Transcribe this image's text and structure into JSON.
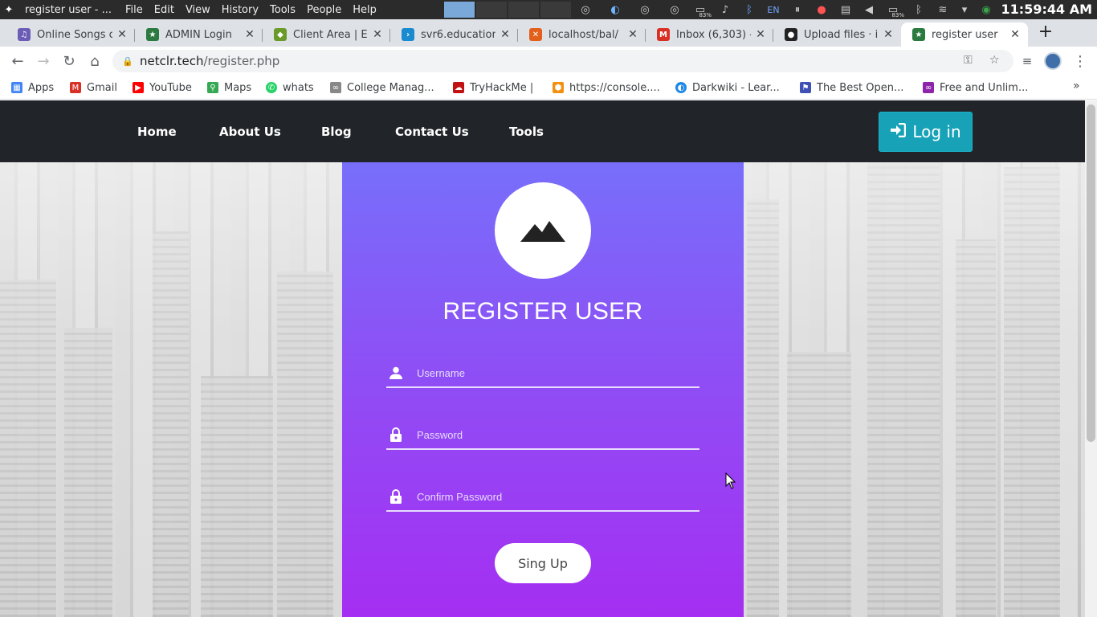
{
  "system_bar": {
    "window_title": "register user - ...",
    "menu": [
      "File",
      "Edit",
      "View",
      "History",
      "Tools",
      "People",
      "Help"
    ],
    "language": "EN",
    "cpu_level": "83%",
    "battery_level": "83%",
    "clock": "11:59:44 AM"
  },
  "tabs": [
    {
      "label": "Online Songs c",
      "icon": "music-favicon",
      "color": "#6b5db5"
    },
    {
      "label": "ADMIN Login",
      "icon": "admin-favicon",
      "color": "#2b7a3f"
    },
    {
      "label": "Client Area | E",
      "icon": "cube-favicon",
      "color": "#6a9a2a"
    },
    {
      "label": "svr6.education",
      "icon": "chevron-favicon",
      "color": "#1a8ad1"
    },
    {
      "label": "localhost/bal/",
      "icon": "xampp-favicon",
      "color": "#e2601c"
    },
    {
      "label": "Inbox (6,303) -",
      "icon": "gmail-favicon",
      "color": "#d93025"
    },
    {
      "label": "Upload files · i",
      "icon": "github-favicon",
      "color": "#222222"
    },
    {
      "label": "register user",
      "icon": "admin-favicon",
      "color": "#2b7a3f",
      "active": true
    }
  ],
  "toolbar": {
    "url_host": "netclr.tech",
    "url_path": "/register.php"
  },
  "bookmarks": [
    {
      "label": "Apps",
      "icon": "apps-grid-icon",
      "color": "#4285f4"
    },
    {
      "label": "Gmail",
      "icon": "gmail-icon",
      "color": "#d93025"
    },
    {
      "label": "YouTube",
      "icon": "youtube-icon",
      "color": "#ff0000"
    },
    {
      "label": "Maps",
      "icon": "maps-pin-icon",
      "color": "#34a853"
    },
    {
      "label": "whats",
      "icon": "whatsapp-icon",
      "color": "#25d366"
    },
    {
      "label": "College Manag...",
      "icon": "link-icon",
      "color": "#888888"
    },
    {
      "label": "TryHackMe |",
      "icon": "tryhackme-icon",
      "color": "#c11111"
    },
    {
      "label": "https://console....",
      "icon": "aws-box-icon",
      "color": "#f29111"
    },
    {
      "label": "Darkwiki - Lear...",
      "icon": "darkwiki-icon",
      "color": "#1e88e5"
    },
    {
      "label": "The Best Open...",
      "icon": "flag-icon",
      "color": "#3f51b5"
    },
    {
      "label": "Free and Unlim...",
      "icon": "loop-icon",
      "color": "#8e24aa"
    }
  ],
  "nav": {
    "links": [
      "Home",
      "About Us",
      "Blog",
      "Contact Us",
      "Tools"
    ],
    "login_label": "Log in"
  },
  "form": {
    "title": "REGISTER USER",
    "username_placeholder": "Username",
    "password_placeholder": "Password",
    "confirm_placeholder": "Confirm Password",
    "submit_label": "Sing Up"
  },
  "colors": {
    "navbar": "#212529",
    "login_button": "#17a2b8",
    "card_top": "#776ffb",
    "card_bottom": "#a52ef2"
  }
}
